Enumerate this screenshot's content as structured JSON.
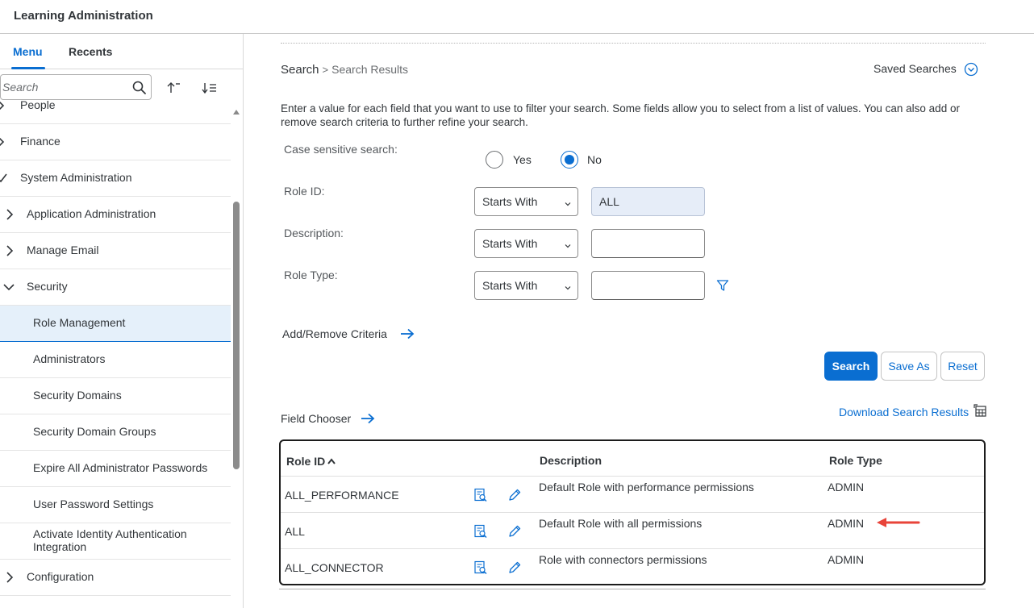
{
  "app": {
    "title": "Learning Administration"
  },
  "sidebar": {
    "tabs": [
      {
        "label": "Menu",
        "active": true
      },
      {
        "label": "Recents",
        "active": false
      }
    ],
    "search": {
      "placeholder": "Search",
      "value": ""
    },
    "items": [
      {
        "label": "People",
        "indent": 0,
        "twisty": "chevron-right"
      },
      {
        "label": "Finance",
        "indent": 0,
        "twisty": "chevron-right"
      },
      {
        "label": "System Administration",
        "indent": 0,
        "twisty": "check"
      },
      {
        "label": "Application Administration",
        "indent": 1,
        "twisty": "chevron-right"
      },
      {
        "label": "Manage Email",
        "indent": 1,
        "twisty": "chevron-right"
      },
      {
        "label": "Security",
        "indent": 1,
        "twisty": "chevron-down"
      },
      {
        "label": "Role Management",
        "indent": 2,
        "selected": true
      },
      {
        "label": "Administrators",
        "indent": 2
      },
      {
        "label": "Security Domains",
        "indent": 2
      },
      {
        "label": "Security Domain Groups",
        "indent": 2
      },
      {
        "label": "Expire All Administrator Passwords",
        "indent": 2
      },
      {
        "label": "User Password Settings",
        "indent": 2
      },
      {
        "label": "Activate Identity Authentication Integration",
        "indent": 2
      },
      {
        "label": "Configuration",
        "indent": 1,
        "twisty": "chevron-right"
      }
    ]
  },
  "main": {
    "breadcrumb": {
      "parent": "Search",
      "separator": ">",
      "current": "Search Results"
    },
    "saved_searches": "Saved Searches",
    "instructions": "Enter a value for each field that you want to use to filter your search. Some fields allow you to select from a list of values. You can also add or remove search criteria to further refine your search.",
    "case_sensitive": {
      "label": "Case sensitive search:",
      "yes": "Yes",
      "no": "No",
      "selected": "No"
    },
    "criteria": [
      {
        "label": "Role ID:",
        "operator": "Starts With",
        "value": "ALL"
      },
      {
        "label": "Description:",
        "operator": "Starts With",
        "value": ""
      },
      {
        "label": "Role Type:",
        "operator": "Starts With",
        "value": ""
      }
    ],
    "add_remove_criteria": "Add/Remove Criteria",
    "buttons": {
      "search": "Search",
      "save_as": "Save As",
      "reset": "Reset"
    },
    "field_chooser": "Field Chooser",
    "download_results": "Download Search Results",
    "table": {
      "columns": [
        "Role ID",
        "Description",
        "Role Type"
      ],
      "rows": [
        {
          "role_id": "ALL_PERFORMANCE",
          "description": "Default Role with performance permissions",
          "role_type": "ADMIN"
        },
        {
          "role_id": "ALL",
          "description": "Default Role with all permissions",
          "role_type": "ADMIN"
        },
        {
          "role_id": "ALL_CONNECTOR",
          "description": "Role with connectors permissions",
          "role_type": "ADMIN"
        }
      ]
    }
  },
  "colors": {
    "accent": "#0a6ed1",
    "annotation_arrow": "#e8443a",
    "selected_bg": "#e5f0fa"
  }
}
